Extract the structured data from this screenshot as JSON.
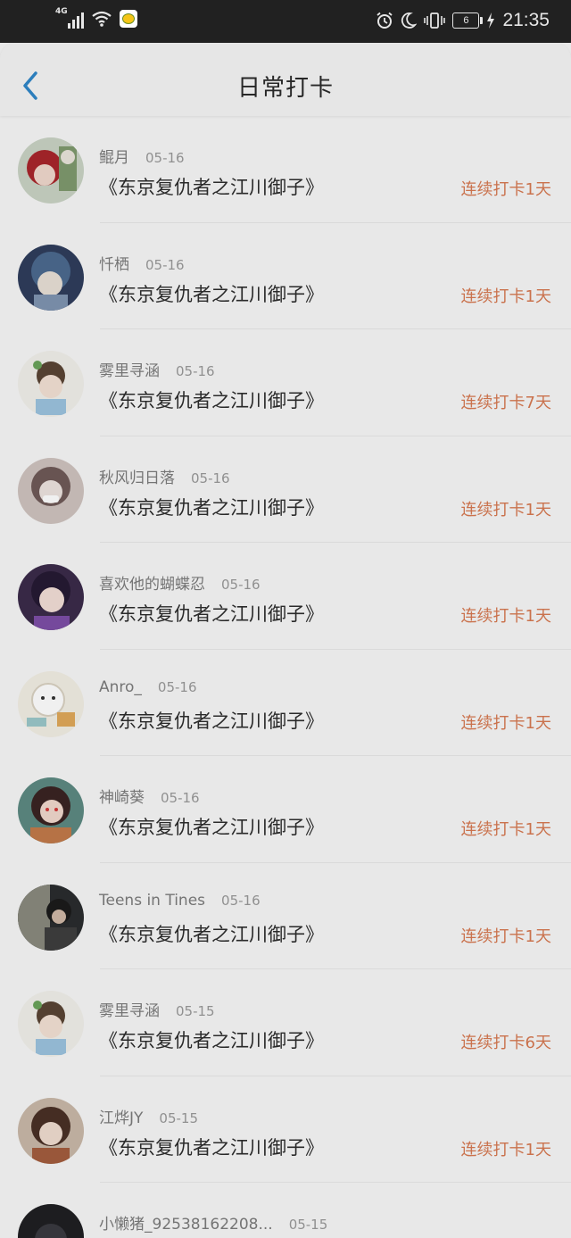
{
  "status_bar": {
    "network": "4G",
    "time": "21:35",
    "battery": "6",
    "icons": [
      "signal-icon",
      "wifi-icon",
      "app-notification-icon",
      "alarm-icon",
      "do-not-disturb-icon",
      "vibrate-icon",
      "battery-icon",
      "charging-icon"
    ]
  },
  "header": {
    "title": "日常打卡",
    "back_icon": "chevron-left-icon",
    "accent_color": "#2f86c8"
  },
  "colors": {
    "streak_text": "#d77a52",
    "name_text": "#7c7c7c",
    "book_text": "#2d2d2d"
  },
  "checkins": [
    {
      "name": "鲲月",
      "date": "05-16",
      "book": "《东京复仇者之江川御子》",
      "streak": "连续打卡1天"
    },
    {
      "name": "忏栖",
      "date": "05-16",
      "book": "《东京复仇者之江川御子》",
      "streak": "连续打卡1天"
    },
    {
      "name": "雾里寻涵",
      "date": "05-16",
      "book": "《东京复仇者之江川御子》",
      "streak": "连续打卡7天"
    },
    {
      "name": "秋风归日落",
      "date": "05-16",
      "book": "《东京复仇者之江川御子》",
      "streak": "连续打卡1天"
    },
    {
      "name": "喜欢他的蝴蝶忍",
      "date": "05-16",
      "book": "《东京复仇者之江川御子》",
      "streak": "连续打卡1天"
    },
    {
      "name": "Anro_",
      "date": "05-16",
      "book": "《东京复仇者之江川御子》",
      "streak": "连续打卡1天"
    },
    {
      "name": "神崎葵",
      "date": "05-16",
      "book": "《东京复仇者之江川御子》",
      "streak": "连续打卡1天"
    },
    {
      "name": "Teens in Tines",
      "date": "05-16",
      "book": "《东京复仇者之江川御子》",
      "streak": "连续打卡1天"
    },
    {
      "name": "雾里寻涵",
      "date": "05-15",
      "book": "《东京复仇者之江川御子》",
      "streak": "连续打卡6天"
    },
    {
      "name": "江烨JY",
      "date": "05-15",
      "book": "《东京复仇者之江川御子》",
      "streak": "连续打卡1天"
    },
    {
      "name": "小懒猪_92538162208...",
      "date": "05-15",
      "book": "",
      "streak": ""
    }
  ]
}
